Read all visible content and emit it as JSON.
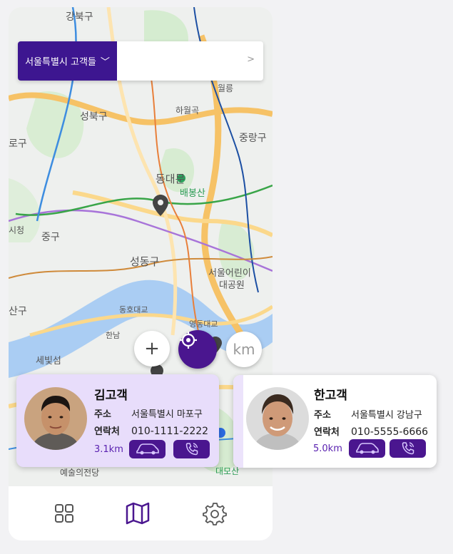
{
  "map": {
    "labels": {
      "gangbuk": "강북구",
      "seongbuk": "성북구",
      "jungnang": "중랑구",
      "dongdaemun": "동대문",
      "baebongsan": "배봉산",
      "jung": "중구",
      "seongdong": "성동구",
      "children_park": "서울어린이",
      "children_park2": "대공원",
      "gu_left": "로구",
      "yongsan": "산구",
      "sebitseom": "세빛섬",
      "arts_center": "예술의전당",
      "daemosan": "대모산",
      "wolgye": "월릉",
      "hawolgok": "하월곡",
      "dongho": "동호대교",
      "yeongdong": "영동대교",
      "hannam": "한남",
      "seoul_city": "시청"
    }
  },
  "region": {
    "selected": "서울특별시 고객들",
    "chevron": "﹀",
    "go": ">"
  },
  "controls": {
    "zoom_in": "+",
    "locate_icon": "crosshair-icon",
    "unit": "km"
  },
  "customers": [
    {
      "name": "김고객",
      "address_label": "주소",
      "address": "서울특별시 마포구",
      "contact_label": "연락처",
      "phone": "010-1111-2222",
      "distance": "3.1km"
    },
    {
      "name": "한고객",
      "address_label": "주소",
      "address": "서울특별시 강남구",
      "contact_label": "연락처",
      "phone": "010-5555-6666",
      "distance": "5.0km"
    }
  ],
  "nav": {
    "items": [
      "grid-icon",
      "map-icon",
      "settings-icon"
    ],
    "active": "map-icon"
  },
  "colors": {
    "accent": "#4a168f",
    "card_bg": "#e8ddfb"
  }
}
